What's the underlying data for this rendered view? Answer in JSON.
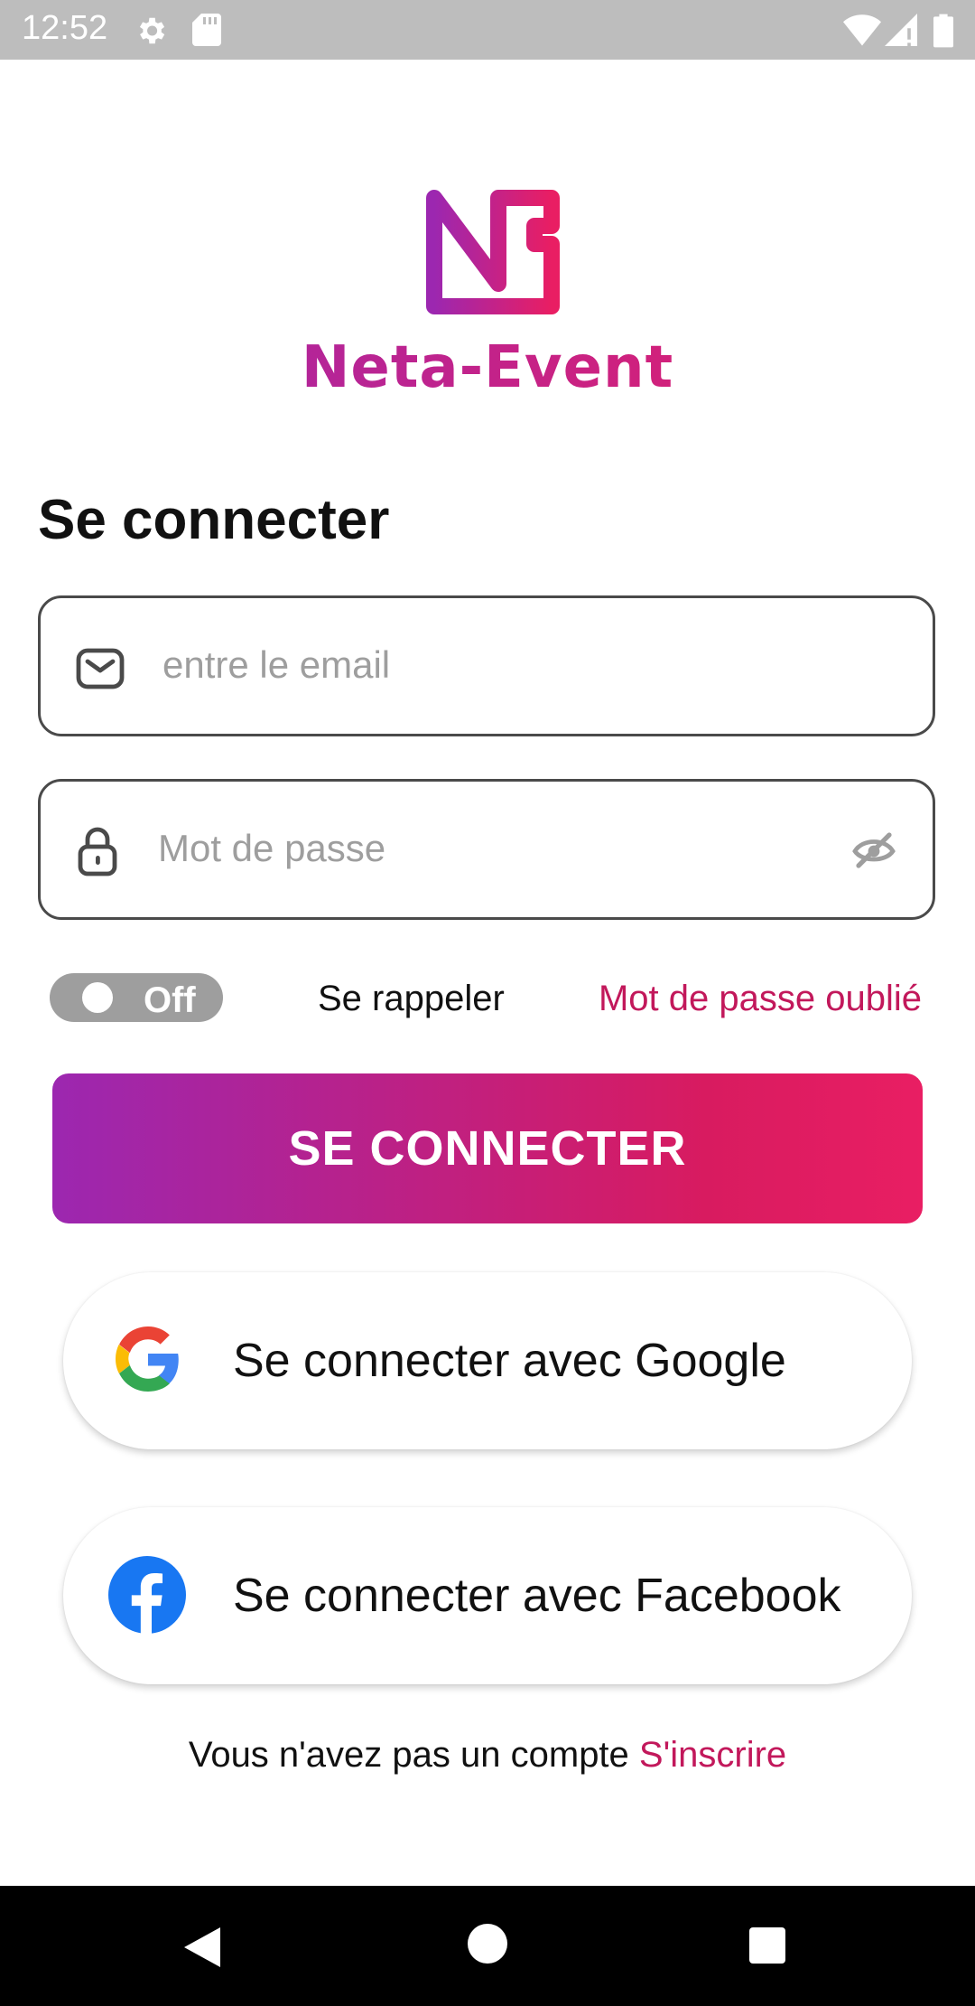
{
  "status_bar": {
    "time": "12:52",
    "icons": [
      "gear-icon",
      "sd-card-icon",
      "wifi-icon",
      "signal-icon",
      "battery-icon"
    ]
  },
  "logo": {
    "brand_name": "Neta-Event",
    "colors": [
      "#9c27b0",
      "#e91e63"
    ]
  },
  "login": {
    "title": "Se connecter",
    "email_placeholder": "entre le email",
    "email_value": "",
    "password_placeholder": "Mot de passe",
    "password_value": "",
    "remember_toggle_state": "off",
    "remember_label": "Se rappeler",
    "forgot_label": "Mot de passe oublié",
    "submit_label": "SE CONNECTER"
  },
  "social": {
    "google_label": "Se connecter avec Google",
    "facebook_label": "Se connecter avec Facebook"
  },
  "signup": {
    "prompt": "Vous n'avez pas un compte",
    "link": "S'inscrire"
  },
  "nav": {
    "icons": [
      "back-icon",
      "home-icon",
      "recents-icon"
    ]
  },
  "colors": {
    "accent": "#c2185b",
    "gradient_start": "#9c27b0",
    "gradient_end": "#e91e63",
    "toggle_off": "#9e9e9e"
  }
}
